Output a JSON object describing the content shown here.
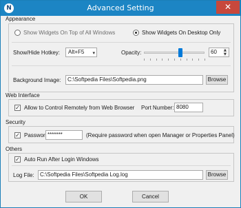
{
  "window": {
    "title": "Advanced Setting",
    "close_glyph": "✕",
    "app_icon_letter": "N"
  },
  "appearance": {
    "label": "Appearance",
    "radio_top": "Show Widgets On Top of All Windows",
    "radio_desktop": "Show Widgets On Desktop Only",
    "selected": "radio_desktop",
    "hotkey_label": "Show/Hide Hotkey:",
    "hotkey_value": "Alt+F5",
    "opacity_label": "Opacity:",
    "opacity_value": "60",
    "opacity_level_percent": 60,
    "background_label": "Background Image:",
    "background_value": "C:\\Softpedia Files\\Softpedia.png",
    "browse_label": "Browse"
  },
  "web_interface": {
    "label": "Web Interface",
    "allow_remote_label": "Allow to Control Remotely from Web Browser",
    "allow_remote_checked": true,
    "port_label": "Port Number:",
    "port_value": "8080"
  },
  "security": {
    "label": "Security",
    "password_label": "Password",
    "password_checked": true,
    "password_value": "*******",
    "note": "(Require password when open Manager or Properties Panel)"
  },
  "others": {
    "label": "Others",
    "autorun_label": "Auto Run After Login Windows",
    "autorun_checked": true,
    "logfile_label": "Log File:",
    "logfile_value": "C:\\Softpedia Files\\Softpedia Log.log",
    "browse_label": "Browse"
  },
  "footer": {
    "ok_label": "OK",
    "cancel_label": "Cancel"
  },
  "icons": {
    "check_glyph": "✓",
    "dropdown_glyph": "▾",
    "spin_up_glyph": "▲",
    "spin_down_glyph": "▼"
  }
}
